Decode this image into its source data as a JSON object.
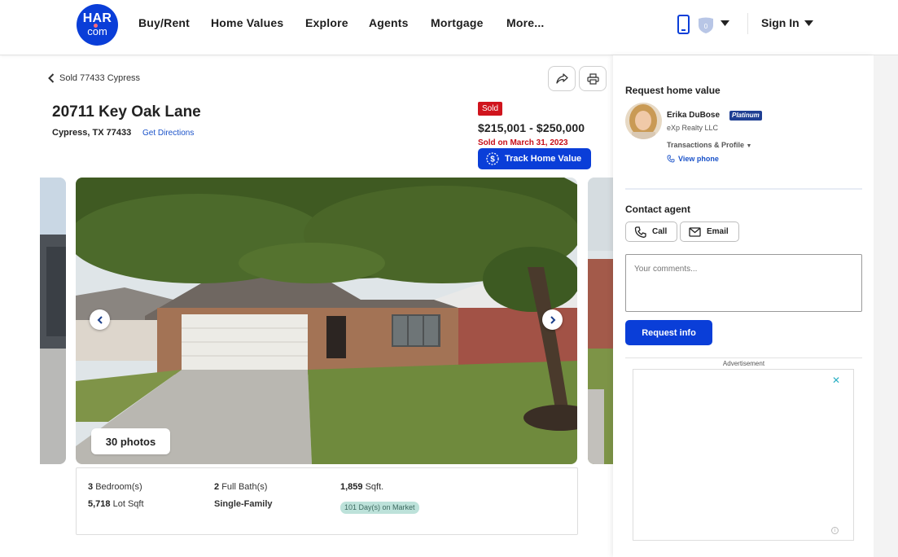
{
  "header": {
    "logo_top": "HAR",
    "logo_bottom": "com",
    "nav": [
      "Buy/Rent",
      "Home Values",
      "Explore",
      "Agents",
      "Mortgage",
      "More..."
    ],
    "badge_count": "0",
    "sign_in": "Sign In"
  },
  "listing": {
    "back_link": "Sold 77433 Cypress",
    "address": "20711 Key Oak Lane",
    "city_state_zip": "Cypress, TX 77433",
    "directions": "Get Directions",
    "status": "Sold",
    "price_range": "$215,001 - $250,000",
    "sold_date": "Sold on March 31, 2023",
    "track_button": "Track Home Value",
    "photos_count": "30 photos"
  },
  "facts": {
    "bedrooms_value": "3",
    "bedrooms_label": "Bedroom(s)",
    "baths_value": "2",
    "baths_label": "Full Bath(s)",
    "sqft_value": "1,859",
    "sqft_label": "Sqft.",
    "lot_value": "5,718",
    "lot_label": "Lot Sqft",
    "type": "Single-Family",
    "days_on_market": "101 Day(s) on Market"
  },
  "panel": {
    "request_title": "Request home value",
    "agent_name": "Erika DuBose",
    "agent_badge": "Platinum",
    "agency": "eXp Realty LLC",
    "transactions": "Transactions & Profile",
    "view_phone": "View phone",
    "contact_title": "Contact agent",
    "call": "Call",
    "email": "Email",
    "comments_placeholder": "Your comments...",
    "request_button": "Request info",
    "ad_label": "Advertisement"
  },
  "colors": {
    "brand_blue": "#0a3ed8",
    "sold_red": "#d0141d",
    "market_badge": "#bde2da"
  }
}
